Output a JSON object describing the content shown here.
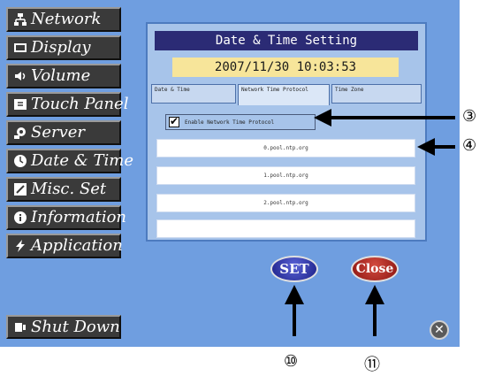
{
  "menu": {
    "items": [
      {
        "label": "Network",
        "icon": "network-icon"
      },
      {
        "label": "Display",
        "icon": "display-icon"
      },
      {
        "label": "Volume",
        "icon": "speaker-icon"
      },
      {
        "label": "Touch Panel",
        "icon": "touch-panel-icon"
      },
      {
        "label": "Server",
        "icon": "server-icon"
      },
      {
        "label": "Date & Time",
        "icon": "clock-icon"
      },
      {
        "label": "Misc. Set",
        "icon": "misc-icon"
      },
      {
        "label": "Information",
        "icon": "info-icon"
      },
      {
        "label": "Application",
        "icon": "lightning-icon"
      }
    ],
    "shutdown_label": "Shut Down"
  },
  "dialog": {
    "title": "Date & Time Setting",
    "current_time": "2007/11/30 10:03:53",
    "tabs": [
      {
        "label": "Date & Time"
      },
      {
        "label": "Network Time Protocol"
      },
      {
        "label": "Time Zone"
      }
    ],
    "ntp_enabled": true,
    "ntp_checkbox_label": "Enable Network Time Protocol",
    "servers": [
      "0.pool.ntp.org",
      "1.pool.ntp.org",
      "2.pool.ntp.org",
      ""
    ]
  },
  "buttons": {
    "set_label": "SET",
    "close_label": "Close"
  },
  "callouts": {
    "c3": "③",
    "c4": "④",
    "c10": "⑩",
    "c11": "⑪"
  },
  "colors": {
    "screen_bg": "#6f9ee0",
    "panel_bg": "#a7c4ea",
    "title_bar": "#2b2b75",
    "time_box": "#f7e59a",
    "set_button": "#2a32a8",
    "close_button": "#a31b14"
  }
}
